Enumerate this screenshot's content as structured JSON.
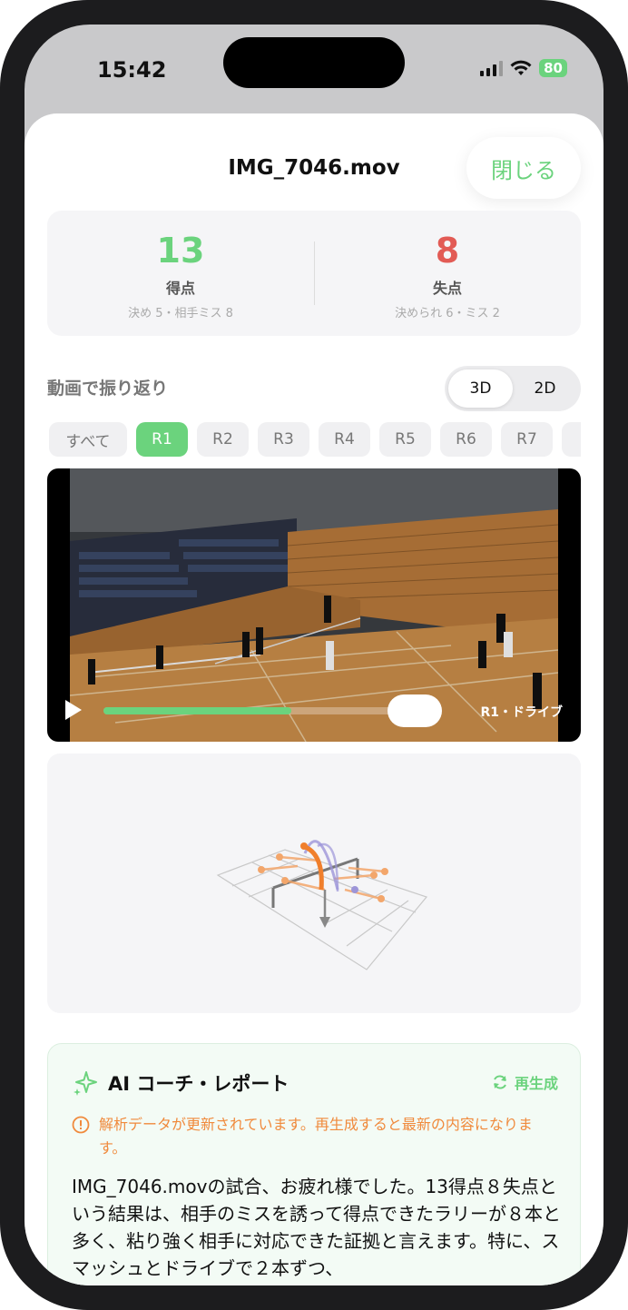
{
  "status_bar": {
    "time": "15:42",
    "battery": "80"
  },
  "header": {
    "title": "IMG_7046.mov",
    "close_label": "閉じる"
  },
  "score": {
    "points": {
      "value": "13",
      "label": "得点",
      "detail": "決め 5・相手ミス 8",
      "color": "#6bd37d"
    },
    "lost": {
      "value": "8",
      "label": "失点",
      "detail": "決められ 6・ミス 2",
      "color": "#e25b55"
    }
  },
  "review": {
    "title": "動画で振り返り",
    "view_toggle": {
      "options": [
        "3D",
        "2D"
      ],
      "selected": "3D"
    },
    "rally_filter": {
      "options": [
        "すべて",
        "R1",
        "R2",
        "R3",
        "R4",
        "R5",
        "R6",
        "R7",
        "R"
      ],
      "selected": "R1"
    }
  },
  "video": {
    "label": "R1・ドライブ",
    "progress": 0.61
  },
  "ai_report": {
    "title": "AI コーチ・レポート",
    "regenerate_label": "再生成",
    "warning": "解析データが更新されています。再生成すると最新の内容になります。",
    "body": "IMG_7046.movの試合、お疲れ様でした。13得点８失点という結果は、相手のミスを誘って得点できたラリーが８本と多く、粘り強く相手に対応できた証拠と言えます。特に、スマッシュとドライブで２本ずつ、"
  },
  "colors": {
    "accent": "#6bd37d",
    "warning": "#f08a3c",
    "lost": "#e25b55"
  }
}
